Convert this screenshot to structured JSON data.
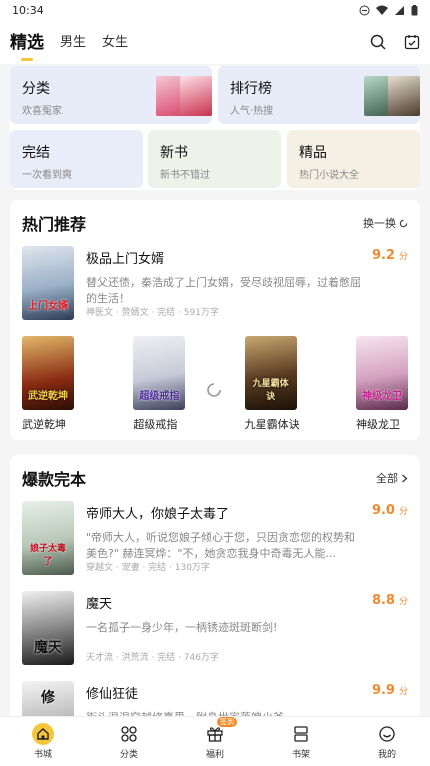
{
  "status_bar": {
    "time": "10:34",
    "icons": [
      "minus-circle-icon",
      "wifi-icon",
      "signal-icon",
      "battery-icon"
    ]
  },
  "top_tabs": [
    {
      "label": "精选",
      "active": true
    },
    {
      "label": "男生",
      "active": false
    },
    {
      "label": "女生",
      "active": false
    }
  ],
  "top_actions": [
    "search-icon",
    "checkin-icon"
  ],
  "quick_entries": [
    {
      "title": "分类",
      "subtitle": "欢喜冤家"
    },
    {
      "title": "排行榜",
      "subtitle": "人气·热搜"
    },
    {
      "title": "完结",
      "subtitle": "一次看到爽"
    },
    {
      "title": "新书",
      "subtitle": "新书不错过"
    },
    {
      "title": "精品",
      "subtitle": "热门小说大全"
    }
  ],
  "hot": {
    "title": "热门推荐",
    "refresh_label": "换一换",
    "featured": {
      "title": "极品上门女婿",
      "score": "9.2",
      "score_unit": "分",
      "desc": "替父还债，秦浩成了上门女婿，受尽歧视屈辱，过着憋屈的生活！",
      "meta": "神医文 · 赘婿文 · 完结 · 591万字",
      "cover_text": "上门女婿"
    },
    "grid": [
      {
        "name": "武逆乾坤",
        "cover_text": "武逆乾坤"
      },
      {
        "name": "超级戒指",
        "cover_text": "超级戒指"
      },
      {
        "name": "九星霸体诀",
        "cover_text": "九星霸体诀"
      },
      {
        "name": "神级龙卫",
        "cover_text": "神级龙卫"
      }
    ]
  },
  "complete": {
    "title": "爆款完本",
    "more_label": "全部",
    "books": [
      {
        "title": "帝师大人，你娘子太毒了",
        "score": "9.0",
        "score_unit": "分",
        "desc": "\"帝师大人，听说您娘子倾心于您，只因贪恋您的权势和美色?\" 赫连冥烨：\"不，她贪恋我身中奇毒无人能...",
        "meta": "穿越文 · 宠妻 · 完结 · 130万字",
        "cover_text": "娘子太毒了"
      },
      {
        "title": "魔天",
        "score": "8.8",
        "score_unit": "分",
        "desc": "一名孤子一身少年，一柄锈迹斑斑断剑!",
        "meta": "天才流 · 洪荒流 · 完结 · 746万字",
        "cover_text": "魔天"
      },
      {
        "title": "修仙狂徒",
        "score": "9.9",
        "score_unit": "分",
        "desc": "街头混混穿越修真界，附身世家落魄少爷。",
        "meta": "",
        "cover_text": "修"
      }
    ]
  },
  "bottom_nav": [
    {
      "label": "书城",
      "icon": "home-icon",
      "active": true
    },
    {
      "label": "分类",
      "icon": "grid-icon",
      "active": false
    },
    {
      "label": "福利",
      "icon": "gift-icon",
      "active": false,
      "badge": "签到"
    },
    {
      "label": "书架",
      "icon": "bookshelf-icon",
      "active": false
    },
    {
      "label": "我的",
      "icon": "profile-icon",
      "active": false
    }
  ],
  "colors": {
    "accent": "#f6c63a",
    "score": "#f08a2c"
  }
}
